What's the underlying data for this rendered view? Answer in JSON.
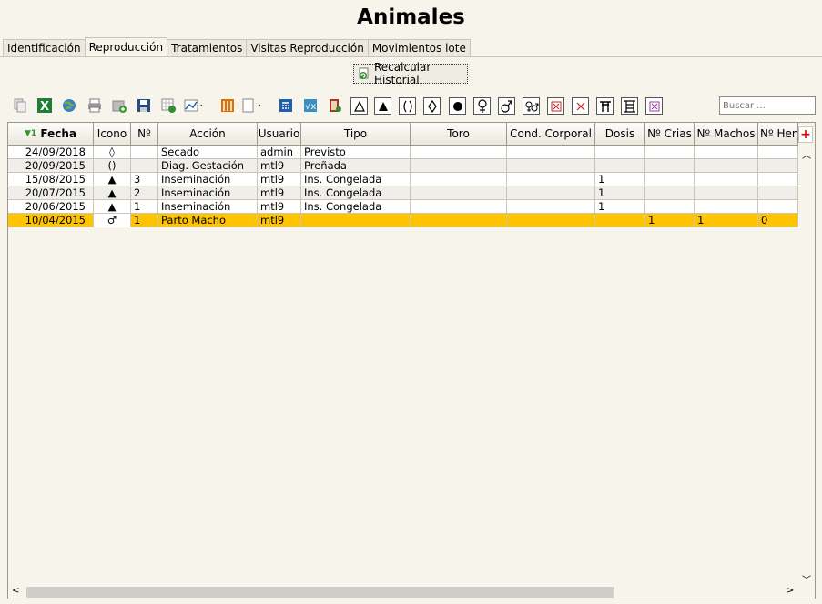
{
  "window": {
    "title": "Animales"
  },
  "tabs": [
    {
      "label": "Identificación",
      "active": false
    },
    {
      "label": "Reproducción",
      "active": true
    },
    {
      "label": "Tratamientos",
      "active": false
    },
    {
      "label": "Visitas Reproducción",
      "active": false
    },
    {
      "label": "Movimientos lote",
      "active": false
    }
  ],
  "recalc": {
    "label": "Recalcular Historial",
    "icon": "recalculate-icon"
  },
  "toolbar": {
    "icons": [
      "copy-icon",
      "excel-icon",
      "globe-icon",
      "print-icon",
      "add-document-icon",
      "save-icon",
      "export-grid-icon",
      "chart-icon",
      "columns-icon",
      "page-icon",
      "calculator-icon",
      "formula-icon",
      "book-icon",
      "triangle-outline-icon",
      "triangle-filled-icon",
      "parentheses-icon",
      "diamond-icon",
      "circle-filled-icon",
      "female-icon",
      "male-icon",
      "male-female-icon",
      "boxed-x-red-icon",
      "x-icon",
      "pi-icon",
      "grid-lines-icon",
      "boxed-x-purple-icon"
    ],
    "accent_colors": {
      "excel": "#1e7e34",
      "orange": "#e07000",
      "red": "#cc2222",
      "blue": "#1f5fb0"
    }
  },
  "search": {
    "placeholder": "Buscar ..."
  },
  "table": {
    "columns": [
      "Fecha",
      "Icono",
      "Nº",
      "Acción",
      "Usuario",
      "Tipo",
      "Toro",
      "Cond. Corporal",
      "Dosis",
      "Nº Crias",
      "Nº Machos",
      "Nº Hem"
    ],
    "sort_indicator": "▼1",
    "rows": [
      {
        "fecha": "24/09/2018",
        "icono": "◊",
        "n": "",
        "accion": "Secado",
        "usuario": "admin",
        "tipo": "Previsto",
        "toro": "",
        "cond": "",
        "dosis": "",
        "crias": "",
        "machos": "",
        "hembras": ""
      },
      {
        "fecha": "20/09/2015",
        "icono": "()",
        "n": "",
        "accion": "Diag. Gestación",
        "usuario": "mtl9",
        "tipo": "Preñada",
        "toro": "",
        "cond": "",
        "dosis": "",
        "crias": "",
        "machos": "",
        "hembras": ""
      },
      {
        "fecha": "15/08/2015",
        "icono": "▲",
        "n": "3",
        "accion": "Inseminación",
        "usuario": "mtl9",
        "tipo": "Ins. Congelada",
        "toro": "",
        "cond": "",
        "dosis": "1",
        "crias": "",
        "machos": "",
        "hembras": ""
      },
      {
        "fecha": "20/07/2015",
        "icono": "▲",
        "n": "2",
        "accion": "Inseminación",
        "usuario": "mtl9",
        "tipo": "Ins. Congelada",
        "toro": "",
        "cond": "",
        "dosis": "1",
        "crias": "",
        "machos": "",
        "hembras": ""
      },
      {
        "fecha": "20/06/2015",
        "icono": "▲",
        "n": "1",
        "accion": "Inseminación",
        "usuario": "mtl9",
        "tipo": "Ins. Congelada",
        "toro": "",
        "cond": "",
        "dosis": "1",
        "crias": "",
        "machos": "",
        "hembras": ""
      },
      {
        "fecha": "10/04/2015",
        "icono": "♂",
        "n": "1",
        "accion": "Parto Macho",
        "usuario": "mtl9",
        "tipo": "",
        "toro": "",
        "cond": "",
        "dosis": "",
        "crias": "1",
        "machos": "1",
        "hembras": "0",
        "selected": true
      }
    ],
    "selected_color": "#ffc400"
  }
}
